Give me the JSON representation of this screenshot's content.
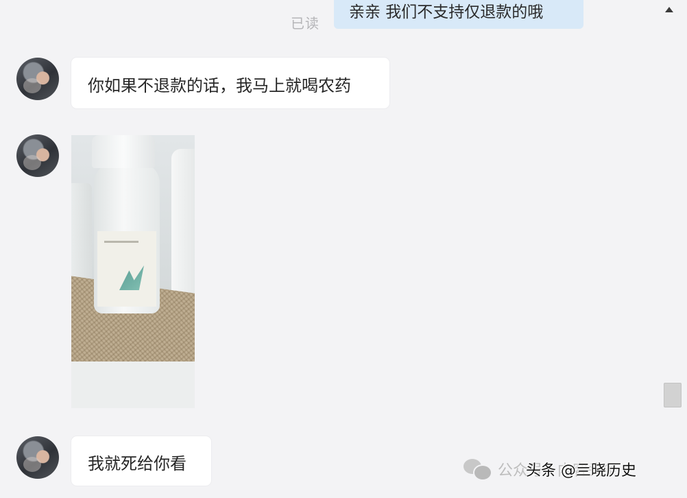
{
  "conversation": {
    "outgoing": {
      "read_status": "已读",
      "text": "亲亲 我们不支持仅退款的哦"
    },
    "incoming": [
      {
        "type": "text",
        "text": "你如果不退款的话，我马上就喝农药"
      },
      {
        "type": "image",
        "alt": "pesticide-bottle-photo"
      },
      {
        "type": "text",
        "text": "我就死给你看"
      }
    ]
  },
  "watermark": {
    "icon": "wechat-icon",
    "official_account": "公众号 · 内容头条",
    "source": "头条 @亖晓历史"
  },
  "colors": {
    "background": "#f3f3f5",
    "outgoing_bubble": "#d8e9f8",
    "incoming_bubble": "#ffffff",
    "read_status": "#b5b5b8"
  }
}
